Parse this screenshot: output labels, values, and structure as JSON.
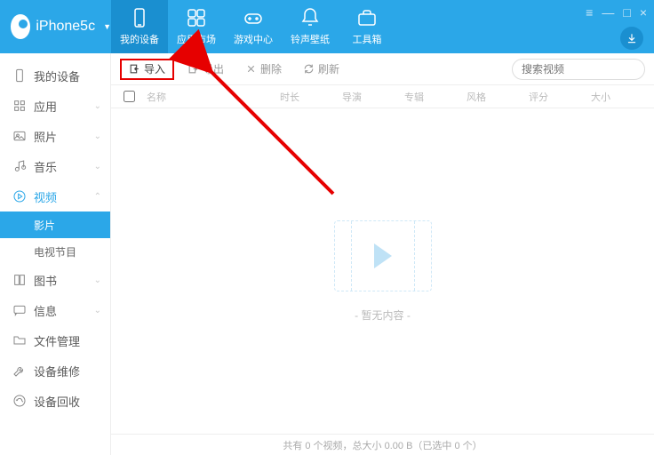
{
  "header": {
    "device_name": "iPhone5c",
    "tabs": [
      {
        "label": "我的设备"
      },
      {
        "label": "应用市场"
      },
      {
        "label": "游戏中心"
      },
      {
        "label": "铃声壁纸"
      },
      {
        "label": "工具箱"
      }
    ]
  },
  "sidebar": {
    "items": [
      {
        "label": "我的设备"
      },
      {
        "label": "应用"
      },
      {
        "label": "照片"
      },
      {
        "label": "音乐"
      },
      {
        "label": "视频"
      },
      {
        "label": "图书"
      },
      {
        "label": "信息"
      },
      {
        "label": "文件管理"
      },
      {
        "label": "设备维修"
      },
      {
        "label": "设备回收"
      }
    ],
    "video_sub": [
      {
        "label": "影片"
      },
      {
        "label": "电视节目"
      }
    ]
  },
  "toolbar": {
    "import_label": "导入",
    "export_label": "导出",
    "delete_label": "删除",
    "refresh_label": "刷新"
  },
  "search": {
    "placeholder": "搜索视频"
  },
  "columns": {
    "name": "名称",
    "duration": "时长",
    "director": "导演",
    "album": "专辑",
    "style": "风格",
    "rating": "评分",
    "size": "大小"
  },
  "empty": {
    "text": "- 暂无内容 -"
  },
  "status": {
    "text": "共有 0 个视频，总大小 0.00 B（已选中 0 个）"
  }
}
